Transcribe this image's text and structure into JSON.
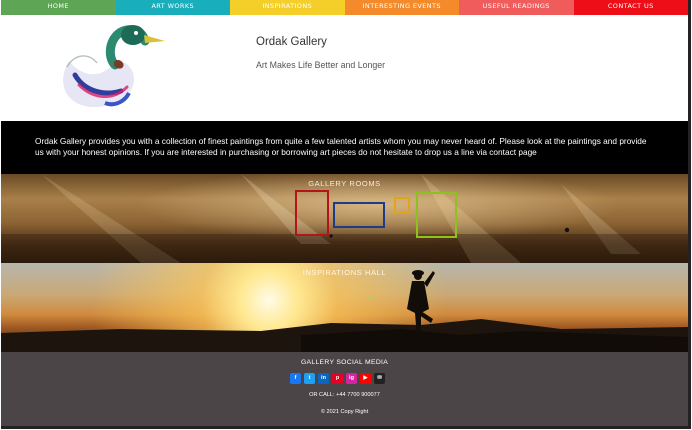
{
  "nav": {
    "items": [
      {
        "label": "HOME",
        "color": "#5fa556"
      },
      {
        "label": "ART WORKS",
        "color": "#19aebb"
      },
      {
        "label": "INSPIRATIONS",
        "color": "#f4cf2a"
      },
      {
        "label": "INTERESTING EVENTS",
        "color": "#f58a2a"
      },
      {
        "label": "USEFUL READINGS",
        "color": "#f05b5b"
      },
      {
        "label": "CONTACT US",
        "color": "#ee0e17"
      }
    ]
  },
  "header": {
    "logo_icon": "duck-logo-icon",
    "title": "Ordak Gallery",
    "tagline": "Art Makes Life Better and Longer"
  },
  "intro": {
    "text": "Ordak Gallery provides you with a collection of finest paintings from quite a few talented artists whom you may never heard of. Please look at the paintings and provide us with your honest opinions. If you are interested in purchasing or borrowing art pieces do not hesitate to drop us a line via  contact page"
  },
  "gallery_rooms": {
    "title": "GALLERY ROOMS",
    "frame_colors": [
      "#b3141a",
      "#1e3a8a",
      "#e0a51a",
      "#8fc11d"
    ]
  },
  "inspirations_hall": {
    "title": "INSPIRATIONS HALL"
  },
  "footer": {
    "social_title": "GALLERY SOCIAL MEDIA",
    "social": [
      {
        "icon": "facebook-icon",
        "glyph": "f",
        "color": "#1877f2"
      },
      {
        "icon": "twitter-icon",
        "glyph": "t",
        "color": "#1da1f2"
      },
      {
        "icon": "linkedin-icon",
        "glyph": "in",
        "color": "#0a66c2"
      },
      {
        "icon": "pinterest-icon",
        "glyph": "p",
        "color": "#e60023"
      },
      {
        "icon": "instagram-icon",
        "glyph": "ig",
        "color": "#d6249f"
      },
      {
        "icon": "youtube-icon",
        "glyph": "▶",
        "color": "#ff0000"
      },
      {
        "icon": "email-icon",
        "glyph": "✉",
        "color": "#222222"
      }
    ],
    "call": "OR CALL: +44 7700 900077",
    "copyright": "© 2021 Copy Right"
  }
}
